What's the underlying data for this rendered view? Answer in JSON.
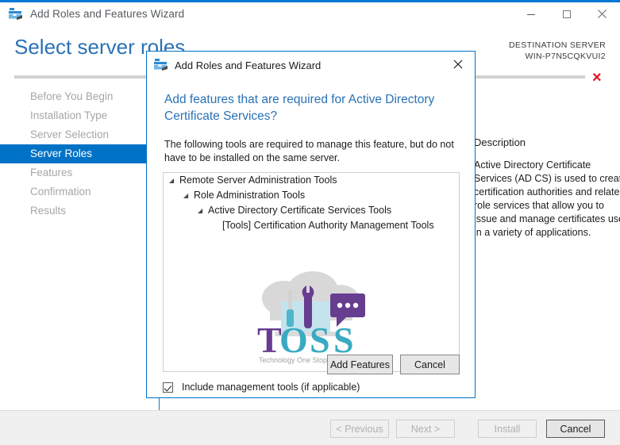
{
  "window": {
    "title": "Add Roles and Features Wizard",
    "icon": "wizard-toolbox-icon",
    "minimize": "minimize",
    "maximize": "maximize",
    "close": "close",
    "accent_color": "#0078d7"
  },
  "page": {
    "title": "Select server roles",
    "destination_label": "DESTINATION SERVER",
    "destination_server": "WIN-P7N5CQKVUI2",
    "error_marker": "×",
    "error_color": "#e81123"
  },
  "sidebar": {
    "items": [
      {
        "label": "Before You Begin",
        "selected": false
      },
      {
        "label": "Installation Type",
        "selected": false
      },
      {
        "label": "Server Selection",
        "selected": false
      },
      {
        "label": "Server Roles",
        "selected": true
      },
      {
        "label": "Features",
        "selected": false
      },
      {
        "label": "Confirmation",
        "selected": false
      },
      {
        "label": "Results",
        "selected": false
      }
    ],
    "selected_color": "#0072c6"
  },
  "description_pane": {
    "title": "Description",
    "body": "Active Directory Certificate Services (AD CS) is used to create certification authorities and related role services that allow you to issue and manage certificates used in a variety of applications."
  },
  "footer": {
    "previous": "< Previous",
    "next": "Next >",
    "install": "Install",
    "cancel": "Cancel"
  },
  "dialog": {
    "title": "Add Roles and Features Wizard",
    "icon": "wizard-toolbox-icon",
    "close": "close",
    "heading": "Add features that are required for Active Directory Certificate Services?",
    "subtext": "The following tools are required to manage this feature, but do not have to be installed on the same server.",
    "tree": [
      {
        "label": "Remote Server Administration Tools",
        "level": 0,
        "arrow": "◢"
      },
      {
        "label": "Role Administration Tools",
        "level": 1,
        "arrow": "◢"
      },
      {
        "label": "Active Directory Certificate Services Tools",
        "level": 2,
        "arrow": "◢"
      },
      {
        "label": "[Tools] Certification Authority Management Tools",
        "level": 3,
        "arrow": ""
      }
    ],
    "checkbox_label": "Include management tools (if applicable)",
    "checkbox_checked": true,
    "add_features": "Add Features",
    "cancel": "Cancel",
    "watermark": {
      "text": "TOSS",
      "tagline": "Technology One Stop Solution"
    }
  }
}
